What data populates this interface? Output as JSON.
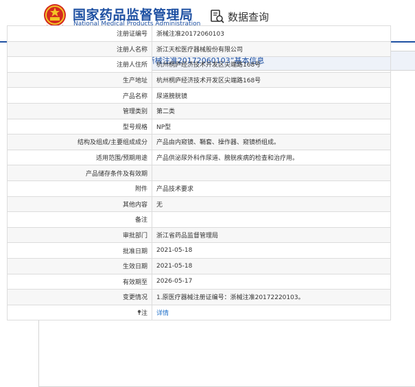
{
  "header": {
    "org_cn": "国家药品监督管理局",
    "org_en": "National Medical Products Administration",
    "search_label": "数据查询"
  },
  "panel": {
    "title": "境内医疗器械（注册）——“浙械注准20172060103”基本信息"
  },
  "rows": [
    {
      "label": "注册证编号",
      "value": "浙械注准20172060103"
    },
    {
      "label": "注册人名称",
      "value": "浙江天松医疗器械股份有限公司"
    },
    {
      "label": "注册人住所",
      "value": "杭州桐庐经济技术开发区尖端路168号"
    },
    {
      "label": "生产地址",
      "value": "杭州桐庐经济技术开发区尖端路168号"
    },
    {
      "label": "产品名称",
      "value": "尿道膀胱镜"
    },
    {
      "label": "管理类别",
      "value": "第二类"
    },
    {
      "label": "型号规格",
      "value": "NP型"
    },
    {
      "label": "结构及组成/主要组成成分",
      "value": "产品由内窥镜、鞘套、操作器、窥镜桥组成。"
    },
    {
      "label": "适用范围/预期用途",
      "value": "产品供泌尿外科作尿道、膀胱疾病的检查和治疗用。"
    },
    {
      "label": "产品储存条件及有效期",
      "value": ""
    },
    {
      "label": "附件",
      "value": "产品技术要求"
    },
    {
      "label": "其他内容",
      "value": "无"
    },
    {
      "label": "备注",
      "value": ""
    },
    {
      "label": "审批部门",
      "value": "浙江省药品监督管理局"
    },
    {
      "label": "批准日期",
      "value": "2021-05-18"
    },
    {
      "label": "生效日期",
      "value": "2021-05-18"
    },
    {
      "label": "有效期至",
      "value": "2026-05-17"
    },
    {
      "label": "变更情况",
      "value": "1.原医疗器械注册证编号：浙械注准20172220103。"
    },
    {
      "label": "注",
      "value": "详情"
    }
  ],
  "colors": {
    "brand": "#1e50a2",
    "link": "#1e6fc9",
    "emblem_red": "#d42a1f",
    "emblem_gold": "#f3c326"
  },
  "icons": {
    "emblem": "national-emblem-icon",
    "search": "search-document-icon",
    "doc": "document-icon",
    "note": "note-marker-icon"
  }
}
